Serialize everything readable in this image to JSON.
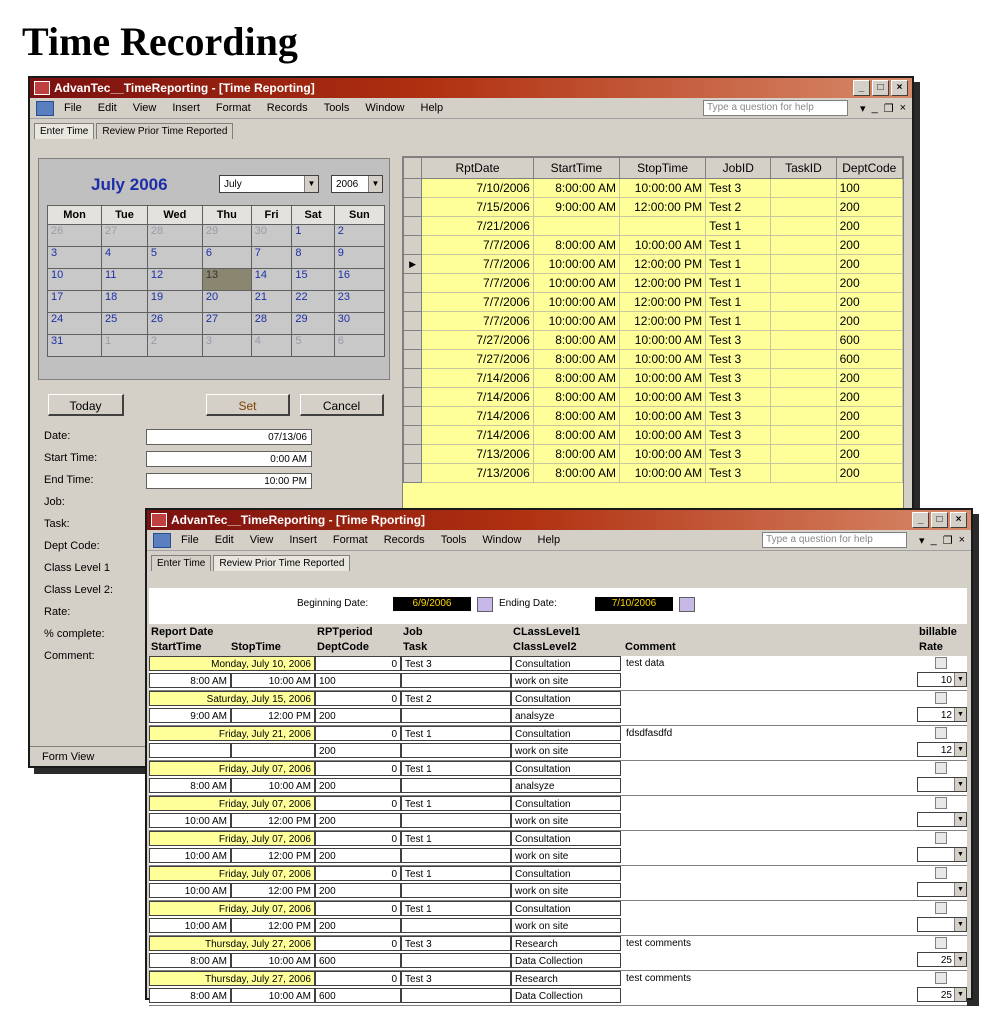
{
  "page_title": "Time Recording",
  "window1": {
    "title": "AdvanTec__TimeReporting - [Time Reporting]",
    "menu": [
      "File",
      "Edit",
      "View",
      "Insert",
      "Format",
      "Records",
      "Tools",
      "Window",
      "Help"
    ],
    "help_placeholder": "Type a question for help",
    "tabs": [
      "Enter Time",
      "Review Prior Time Reported"
    ],
    "calendar": {
      "month_label": "July 2006",
      "month_select": "July",
      "year_select": "2006",
      "weekdays": [
        "Mon",
        "Tue",
        "Wed",
        "Thu",
        "Fri",
        "Sat",
        "Sun"
      ],
      "weeks": [
        [
          "26",
          "27",
          "28",
          "29",
          "30",
          "1",
          "2"
        ],
        [
          "3",
          "4",
          "5",
          "6",
          "7",
          "8",
          "9"
        ],
        [
          "10",
          "11",
          "12",
          "13",
          "14",
          "15",
          "16"
        ],
        [
          "17",
          "18",
          "19",
          "20",
          "21",
          "22",
          "23"
        ],
        [
          "24",
          "25",
          "26",
          "27",
          "28",
          "29",
          "30"
        ],
        [
          "31",
          "1",
          "2",
          "3",
          "4",
          "5",
          "6"
        ]
      ],
      "today_day": "13"
    },
    "buttons": {
      "today": "Today",
      "set": "Set",
      "cancel": "Cancel"
    },
    "form_labels": [
      "Date:",
      "Start Time:",
      "End Time:",
      "Job:",
      "Task:",
      "Dept Code:",
      "Class Level 1",
      "Class Level 2:",
      "Rate:",
      "% complete:",
      "Comment:"
    ],
    "form_values": {
      "date": "07/13/06",
      "start_time": "0:00 AM",
      "end_time": "10:00 PM"
    },
    "status": "Form View",
    "grid": {
      "columns": [
        "RptDate",
        "StartTime",
        "StopTime",
        "JobID",
        "TaskID",
        "DeptCode"
      ],
      "rows": [
        [
          "7/10/2006",
          "8:00:00 AM",
          "10:00:00 AM",
          "Test 3",
          "",
          "100"
        ],
        [
          "7/15/2006",
          "9:00:00 AM",
          "12:00:00 PM",
          "Test 2",
          "",
          "200"
        ],
        [
          "7/21/2006",
          "",
          "",
          "Test 1",
          "",
          "200"
        ],
        [
          "7/7/2006",
          "8:00:00 AM",
          "10:00:00 AM",
          "Test 1",
          "",
          "200"
        ],
        [
          "7/7/2006",
          "10:00:00 AM",
          "12:00:00 PM",
          "Test 1",
          "",
          "200"
        ],
        [
          "7/7/2006",
          "10:00:00 AM",
          "12:00:00 PM",
          "Test 1",
          "",
          "200"
        ],
        [
          "7/7/2006",
          "10:00:00 AM",
          "12:00:00 PM",
          "Test 1",
          "",
          "200"
        ],
        [
          "7/7/2006",
          "10:00:00 AM",
          "12:00:00 PM",
          "Test 1",
          "",
          "200"
        ],
        [
          "7/27/2006",
          "8:00:00 AM",
          "10:00:00 AM",
          "Test 3",
          "",
          "600"
        ],
        [
          "7/27/2006",
          "8:00:00 AM",
          "10:00:00 AM",
          "Test 3",
          "",
          "600"
        ],
        [
          "7/14/2006",
          "8:00:00 AM",
          "10:00:00 AM",
          "Test 3",
          "",
          "200"
        ],
        [
          "7/14/2006",
          "8:00:00 AM",
          "10:00:00 AM",
          "Test 3",
          "",
          "200"
        ],
        [
          "7/14/2006",
          "8:00:00 AM",
          "10:00:00 AM",
          "Test 3",
          "",
          "200"
        ],
        [
          "7/14/2006",
          "8:00:00 AM",
          "10:00:00 AM",
          "Test 3",
          "",
          "200"
        ],
        [
          "7/13/2006",
          "8:00:00 AM",
          "10:00:00 AM",
          "Test 3",
          "",
          "200"
        ],
        [
          "7/13/2006",
          "8:00:00 AM",
          "10:00:00 AM",
          "Test 3",
          "",
          "200"
        ]
      ],
      "current_row": 4
    }
  },
  "window2": {
    "title": "AdvanTec__TimeReporting - [Time Rporting]",
    "menu": [
      "File",
      "Edit",
      "View",
      "Insert",
      "Format",
      "Records",
      "Tools",
      "Window",
      "Help"
    ],
    "help_placeholder": "Type a question for help",
    "tabs": [
      "Enter Time",
      "Review Prior Time Reported"
    ],
    "beginning_label": "Beginning Date:",
    "beginning_value": "6/9/2006",
    "ending_label": "Ending Date:",
    "ending_value": "7/10/2006",
    "headers": {
      "report_date": "Report Date",
      "start_time": "StartTime",
      "stop_time": "StopTime",
      "rpt_period": "RPTperiod",
      "dept_code": "DeptCode",
      "job": "Job",
      "task": "Task",
      "class1": "CLassLevel1",
      "class2": "ClassLevel2",
      "comment": "Comment",
      "billable": "billable",
      "rate": "Rate"
    },
    "records": [
      {
        "date": "Monday, July 10, 2006",
        "period": "0",
        "job": "Test 3",
        "class1": "Consultation",
        "comment": "test data",
        "start": "8:00 AM",
        "stop": "10:00 AM",
        "dept": "100",
        "task": "",
        "class2": "work on site",
        "rate": "10"
      },
      {
        "date": "Saturday, July 15, 2006",
        "period": "0",
        "job": "Test 2",
        "class1": "Consultation",
        "comment": "",
        "start": "9:00 AM",
        "stop": "12:00 PM",
        "dept": "200",
        "task": "",
        "class2": "analsyze",
        "rate": "12"
      },
      {
        "date": "Friday, July 21, 2006",
        "period": "0",
        "job": "Test 1",
        "class1": "Consultation",
        "comment": "fdsdfasdfd",
        "start": "",
        "stop": "",
        "dept": "200",
        "task": "",
        "class2": "work on site",
        "rate": "12"
      },
      {
        "date": "Friday, July 07, 2006",
        "period": "0",
        "job": "Test 1",
        "class1": "Consultation",
        "comment": "",
        "start": "8:00 AM",
        "stop": "10:00 AM",
        "dept": "200",
        "task": "",
        "class2": "analsyze",
        "rate": ""
      },
      {
        "date": "Friday, July 07, 2006",
        "period": "0",
        "job": "Test 1",
        "class1": "Consultation",
        "comment": "",
        "start": "10:00 AM",
        "stop": "12:00 PM",
        "dept": "200",
        "task": "",
        "class2": "work on site",
        "rate": ""
      },
      {
        "date": "Friday, July 07, 2006",
        "period": "0",
        "job": "Test 1",
        "class1": "Consultation",
        "comment": "",
        "start": "10:00 AM",
        "stop": "12:00 PM",
        "dept": "200",
        "task": "",
        "class2": "work on site",
        "rate": ""
      },
      {
        "date": "Friday, July 07, 2006",
        "period": "0",
        "job": "Test 1",
        "class1": "Consultation",
        "comment": "",
        "start": "10:00 AM",
        "stop": "12:00 PM",
        "dept": "200",
        "task": "",
        "class2": "work on site",
        "rate": ""
      },
      {
        "date": "Friday, July 07, 2006",
        "period": "0",
        "job": "Test 1",
        "class1": "Consultation",
        "comment": "",
        "start": "10:00 AM",
        "stop": "12:00 PM",
        "dept": "200",
        "task": "",
        "class2": "work on site",
        "rate": ""
      },
      {
        "date": "Thursday, July 27, 2006",
        "period": "0",
        "job": "Test 3",
        "class1": "Research",
        "comment": "test comments",
        "start": "8:00 AM",
        "stop": "10:00 AM",
        "dept": "600",
        "task": "",
        "class2": "Data Collection",
        "rate": "25"
      },
      {
        "date": "Thursday, July 27, 2006",
        "period": "0",
        "job": "Test 3",
        "class1": "Research",
        "comment": "test comments",
        "start": "8:00 AM",
        "stop": "10:00 AM",
        "dept": "600",
        "task": "",
        "class2": "Data Collection",
        "rate": "25"
      }
    ]
  }
}
